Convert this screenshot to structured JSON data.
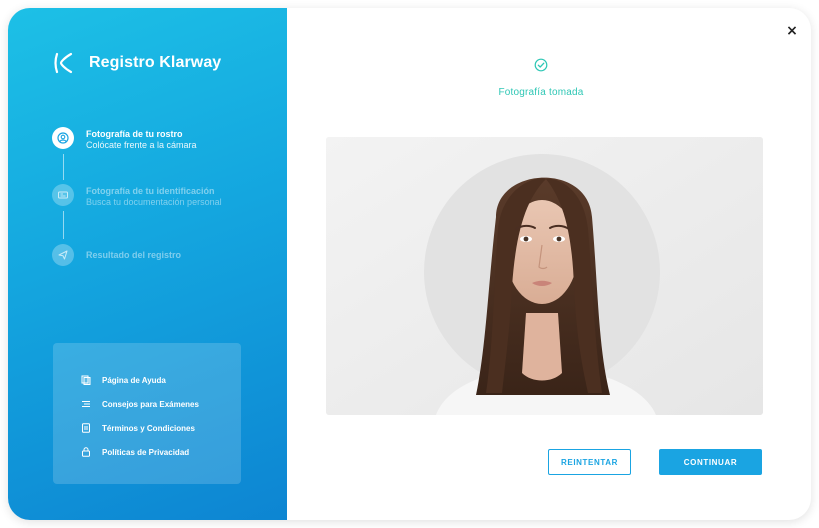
{
  "app": {
    "title": "Registro Klarway"
  },
  "steps": [
    {
      "title": "Fotografía de tu rostro",
      "subtitle": "Colócate frente a la cámara",
      "state": "active",
      "icon": "face-icon"
    },
    {
      "title": "Fotografía de tu identificación",
      "subtitle": "Busca tu documentación personal",
      "state": "pending",
      "icon": "id-card-icon"
    },
    {
      "title": "Resultado del registro",
      "subtitle": "",
      "state": "pending",
      "icon": "send-icon"
    }
  ],
  "help_links": [
    {
      "label": "Página de Ayuda",
      "icon": "help-page-icon"
    },
    {
      "label": "Consejos para Exámenes",
      "icon": "tips-icon"
    },
    {
      "label": "Términos y Condiciones",
      "icon": "document-icon"
    },
    {
      "label": "Políticas de Privacidad",
      "icon": "lock-icon"
    }
  ],
  "status": {
    "text": "Fotografía tomada",
    "icon": "check-circle-icon"
  },
  "buttons": {
    "retry": "REINTENTAR",
    "continue": "CONTINUAR"
  },
  "colors": {
    "sidebar_top": "#1dc0e6",
    "sidebar_bottom": "#0d85d2",
    "accent": "#1aa4e2",
    "success": "#2fc7b5"
  }
}
